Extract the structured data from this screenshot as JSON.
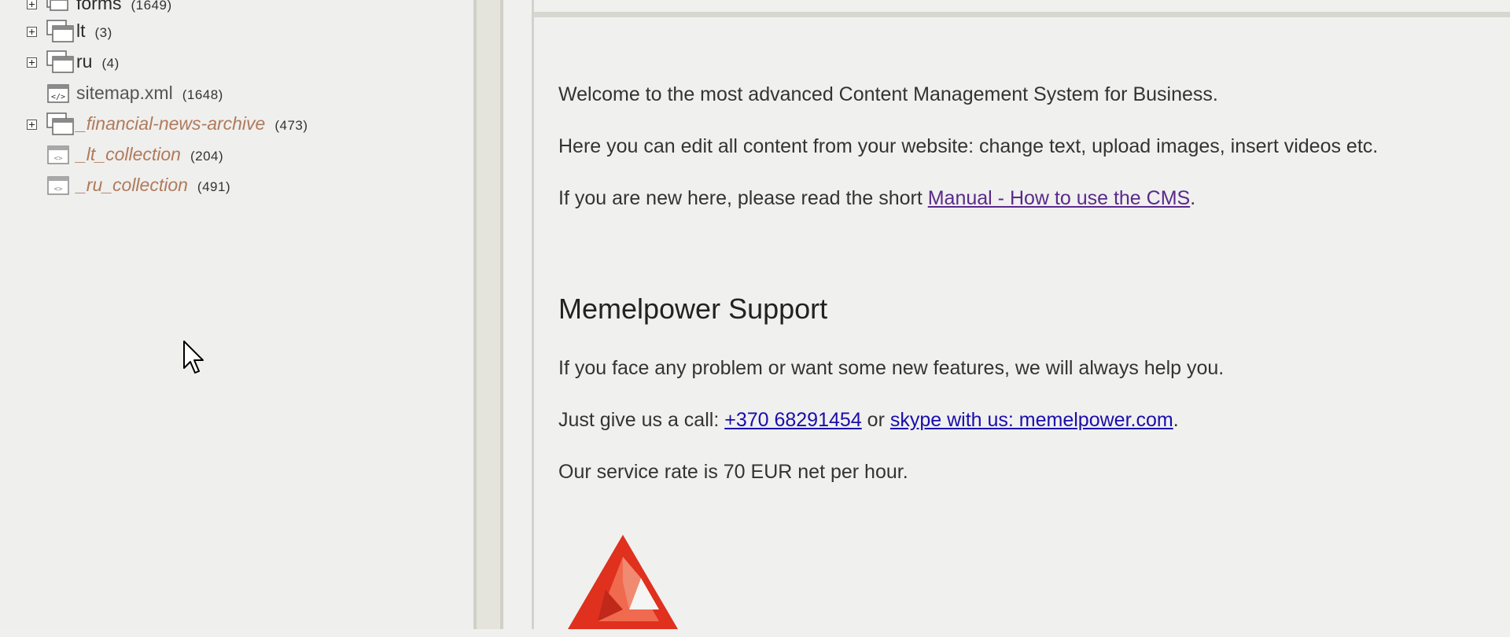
{
  "tree": {
    "items": [
      {
        "label": "forms",
        "count": "(1649)",
        "type": "folder",
        "style": "normal",
        "expandable": true
      },
      {
        "label": "lt",
        "count": "(3)",
        "type": "folder",
        "style": "normal",
        "expandable": true
      },
      {
        "label": "ru",
        "count": "(4)",
        "type": "folder",
        "style": "normal",
        "expandable": true
      },
      {
        "label": "sitemap.xml",
        "count": "(1648)",
        "type": "xml-file",
        "style": "file",
        "expandable": false
      },
      {
        "label": "_financial-news-archive",
        "count": "(473)",
        "type": "folder",
        "style": "italic",
        "expandable": true
      },
      {
        "label": "_lt_collection",
        "count": "(204)",
        "type": "page",
        "style": "italic",
        "expandable": false
      },
      {
        "label": "_ru_collection",
        "count": "(491)",
        "type": "page",
        "style": "italic",
        "expandable": false
      }
    ]
  },
  "content": {
    "welcome": "Welcome to the most advanced Content Management System for Business.",
    "edit_info": "Here you can edit all content from your website: change text, upload images, insert videos etc.",
    "manual_prefix": "If you are new here, please read the short ",
    "manual_link": "Manual - How to use the CMS",
    "manual_suffix": ".",
    "support_heading": "Memelpower Support",
    "support_text": "If you face any problem or want some new features, we will always help you.",
    "call_prefix": "Just give us a call: ",
    "phone_link": "+370 68291454",
    "call_or": " or ",
    "skype_link": "skype with us: memelpower.com",
    "call_suffix": ".",
    "rate_text": "Our service rate is 70 EUR net per hour."
  },
  "colors": {
    "link": "#1a0dab",
    "visited_link": "#5a2a8a",
    "italic_node": "#b07a5a",
    "logo_red": "#e0301e"
  },
  "icons": {
    "expander": "plus-box-icon",
    "folder": "folder-stack-icon",
    "xml": "xml-file-icon",
    "page": "page-icon",
    "cursor": "mouse-pointer-icon",
    "logo": "memelpower-logo-icon"
  }
}
